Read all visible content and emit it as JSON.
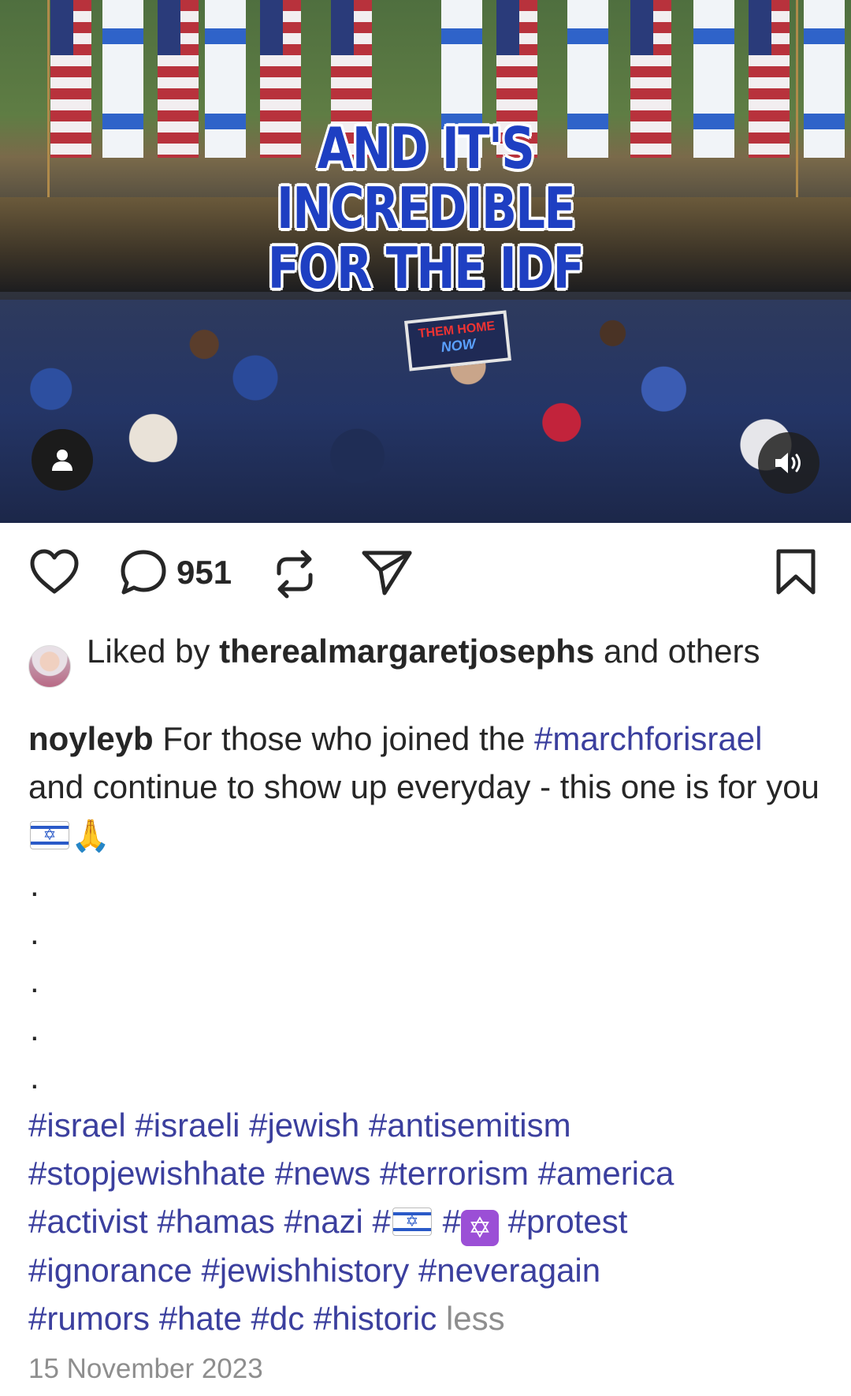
{
  "media": {
    "overlay_lines": [
      "AND IT'S",
      "INCREDIBLE",
      "FOR THE IDF"
    ],
    "sign_top": "THEM HOME",
    "sign_bottom": "NOW",
    "user_tag_icon": "user-icon",
    "sound_icon": "speaker-icon"
  },
  "actions": {
    "like_icon": "heart-icon",
    "comment_icon": "comment-icon",
    "comment_count": "951",
    "repost_icon": "repost-icon",
    "share_icon": "send-icon",
    "save_icon": "bookmark-icon"
  },
  "likes": {
    "prefix": "Liked by",
    "user": "therealmargaretjosephs",
    "suffix": "and others"
  },
  "caption": {
    "username": "noyleyb",
    "text_1": "For those who joined the",
    "hashtag_main": "#marchforisrael",
    "text_2": "and continue to show up everyday - this one is for you",
    "dots": [
      ".",
      ".",
      ".",
      ".",
      "."
    ],
    "hashtags_line1": "#israel #israeli #jewish #antisemitism",
    "hashtags_line2": "#stopjewishhate #news #terrorism #america",
    "hashtags_line3_a": "#activist #hamas #nazi #",
    "hashtags_line3_b": "#",
    "hashtags_line3_c": "#protest",
    "hashtags_line4": "#ignorance #jewishhistory #neveragain",
    "hashtags_line5": "#rumors #hate #dc #historic",
    "less_label": "less"
  },
  "date": "15 November 2023",
  "colors": {
    "hashtag": "#3b3f9e",
    "overlay_text": "#1e3fc2",
    "muted": "#8e8e8e"
  }
}
